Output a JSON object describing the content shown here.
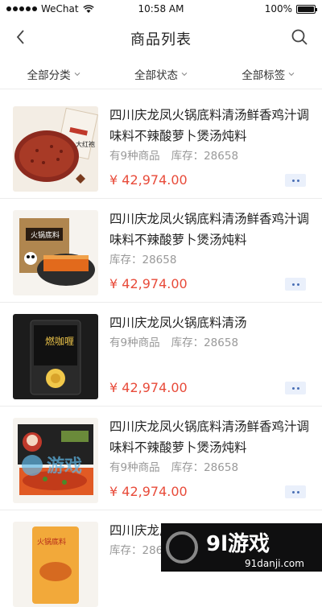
{
  "status_bar": {
    "carrier": "WeChat",
    "time": "10:58 AM",
    "battery": "100%",
    "battery_level": 1.0
  },
  "header": {
    "title": "商品列表",
    "back_icon": "chevron-left-icon",
    "search_icon": "search-icon"
  },
  "filters": [
    {
      "label": "全部分类"
    },
    {
      "label": "全部状态"
    },
    {
      "label": "全部标签"
    }
  ],
  "products": [
    {
      "title": "四川庆龙凤火锅底料清汤鲜香鸡汁调味料不辣酸萝卜煲汤炖料",
      "count": "有9种商品",
      "stock": "库存：28658",
      "price": "¥ 42,974.00"
    },
    {
      "title": "四川庆龙凤火锅底料清汤鲜香鸡汁调味料不辣酸萝卜煲汤炖料",
      "count": "",
      "stock": "库存：28658",
      "price": "¥ 42,974.00"
    },
    {
      "title": "四川庆龙凤火锅底料清汤",
      "count": "有9种商品",
      "stock": "库存：28658",
      "price": "¥ 42,974.00"
    },
    {
      "title": "四川庆龙凤火锅底料清汤鲜香鸡汁调味料不辣酸萝卜煲汤炖料",
      "count": "有9种商品",
      "stock": "库存：28658",
      "price": "¥ 42,974.00"
    },
    {
      "title": "四川庆龙凤火锅底料清汤",
      "count": "",
      "stock": "库存：28658",
      "price": ""
    }
  ],
  "package_labels": {
    "p1": "大红袍",
    "p2": "火锅底料",
    "p3": "燃咖喱",
    "p5": "火锅底料"
  },
  "watermarks": {
    "left": "游戏",
    "right_main": "9l游戏",
    "right_sub": "91danji.com"
  },
  "colors": {
    "price": "#e84b3a",
    "more_button_bg": "#eaf0fb",
    "more_button_dots": "#4a6fb5"
  }
}
